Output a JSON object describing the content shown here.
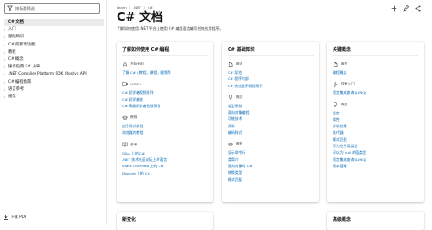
{
  "sidebar": {
    "filter_placeholder": "按标题筛选",
    "items": [
      {
        "label": "C# 文档",
        "chevron": "",
        "selected": true
      },
      {
        "label": "入门",
        "chevron": "›"
      },
      {
        "label": "基础知识",
        "chevron": "›"
      },
      {
        "label": "C# 的新增功能",
        "chevron": "›"
      },
      {
        "label": "教程",
        "chevron": "›"
      },
      {
        "label": "C# 概念",
        "chevron": "›"
      },
      {
        "label": "操作指南 C# 文章",
        "chevron": "›"
      },
      {
        "label": ".NET Compiler Platform SDK (Roslyn API)",
        "chevron": "›"
      },
      {
        "label": "C# 编程指南",
        "chevron": "›"
      },
      {
        "label": "语言参考",
        "chevron": "›"
      },
      {
        "label": "规范",
        "chevron": "›"
      }
    ],
    "pdf_label": "下载 PDF"
  },
  "breadcrumb": [
    "Learn",
    ".NET",
    "C#"
  ],
  "page": {
    "title": "C# 文档",
    "summary": "了解如何使用 .NET 平台上使用 C# 编程语言编写任何应用程序。"
  },
  "cards": {
    "learn": {
      "title": "了解如何使用 C# 编程",
      "sections": [
        {
          "head": "开始使用",
          "links": [
            "了解 C# | 教程、课程、视频等"
          ]
        },
        {
          "head": "VIDEO",
          "links": [
            "C# 初学者视频系列",
            "C# 初学者流",
            "C# 高级初学者视频系列"
          ]
        },
        {
          "head": "教程",
          "links": [
            "自引导式教程",
            "浏览器内教程"
          ]
        },
        {
          "head": "参考",
          "links": [
            "Q&A 上的 C#",
            ".NET 技术社区论坛上的语言",
            "Stack Overflow 上的 C#",
            "Discord 上的 C#"
          ]
        }
      ]
    },
    "basics": {
      "title": "C# 基础知识",
      "sections": [
        {
          "head": "概述",
          "links": [
            "C# 导览",
            "C# 程序内部",
            "C# 突出显示视频系列"
          ]
        },
        {
          "head": "概念",
          "links": [
            "类型系统",
            "面向对象编程",
            "功能技术",
            "异常",
            "编码样式"
          ]
        },
        {
          "head": "教程",
          "links": [
            "显示命令行",
            "类简介",
            "面向对象的 C#",
            "转换类型",
            "模式匹配"
          ]
        }
      ]
    },
    "key": {
      "title": "关键概念",
      "sections": [
        {
          "head": "概述",
          "links": [
            "编程概念"
          ]
        },
        {
          "head": "快速入门",
          "links": [
            "语言集成查询 (LINQ)"
          ]
        },
        {
          "head": "概念",
          "links": [
            "异步",
            "属性",
            "异常处理",
            "迭代器",
            "模式匹配",
            "可为空引用类型",
            "可以为 null 的值类型",
            "语言集成查询 (LINQ)",
            "版本管理"
          ]
        }
      ]
    },
    "bottom_left": {
      "title": "新变化"
    },
    "bottom_right": {
      "title": "高级概念"
    }
  }
}
